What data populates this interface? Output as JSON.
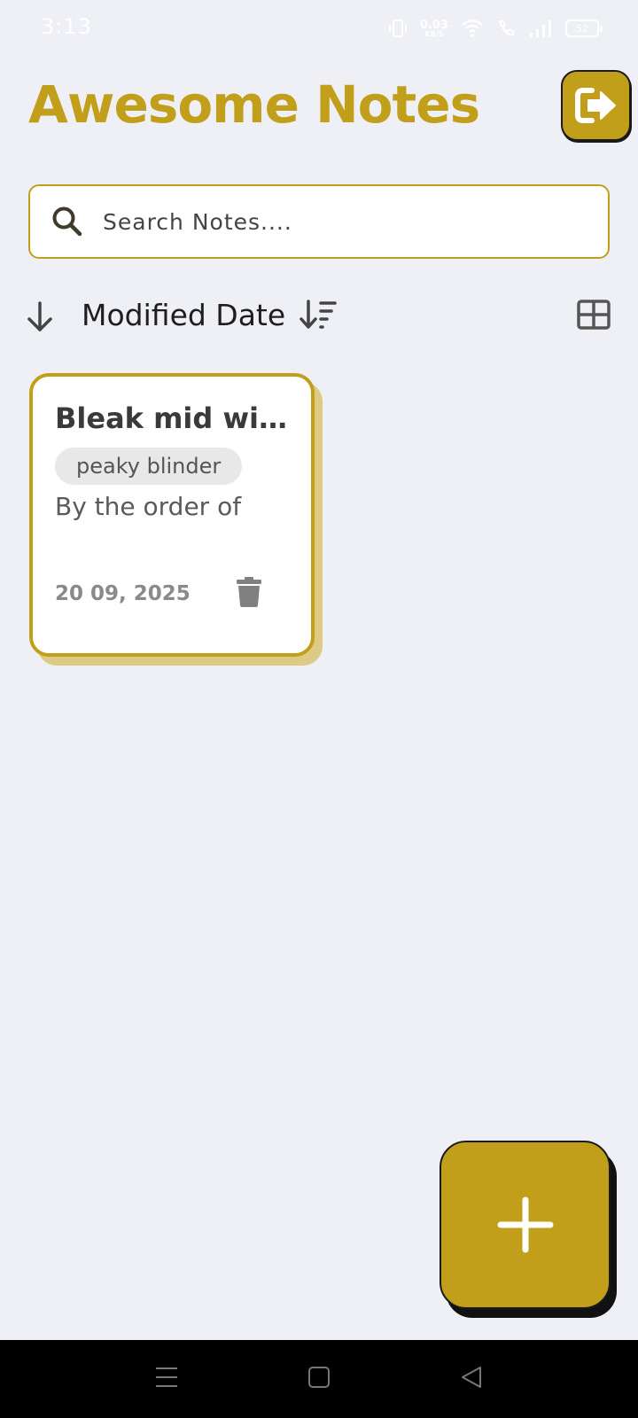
{
  "status_bar": {
    "time": "3:13",
    "net_speed_value": "0.03",
    "net_speed_unit": "KB/S",
    "battery": "52"
  },
  "header": {
    "title": "Awesome Notes",
    "logout_icon": "logout-icon"
  },
  "search": {
    "placeholder": "Search Notes....",
    "icon": "search-icon"
  },
  "sort": {
    "label": "Modified Date",
    "direction": "descending"
  },
  "notes": [
    {
      "title": "Bleak mid win...",
      "tag": "peaky blinder",
      "body": "By the order of",
      "date": "20 09, 2025"
    }
  ],
  "colors": {
    "accent": "#c29f1a",
    "background": "#eff0f5",
    "card_shadow": "#ddcb85"
  }
}
